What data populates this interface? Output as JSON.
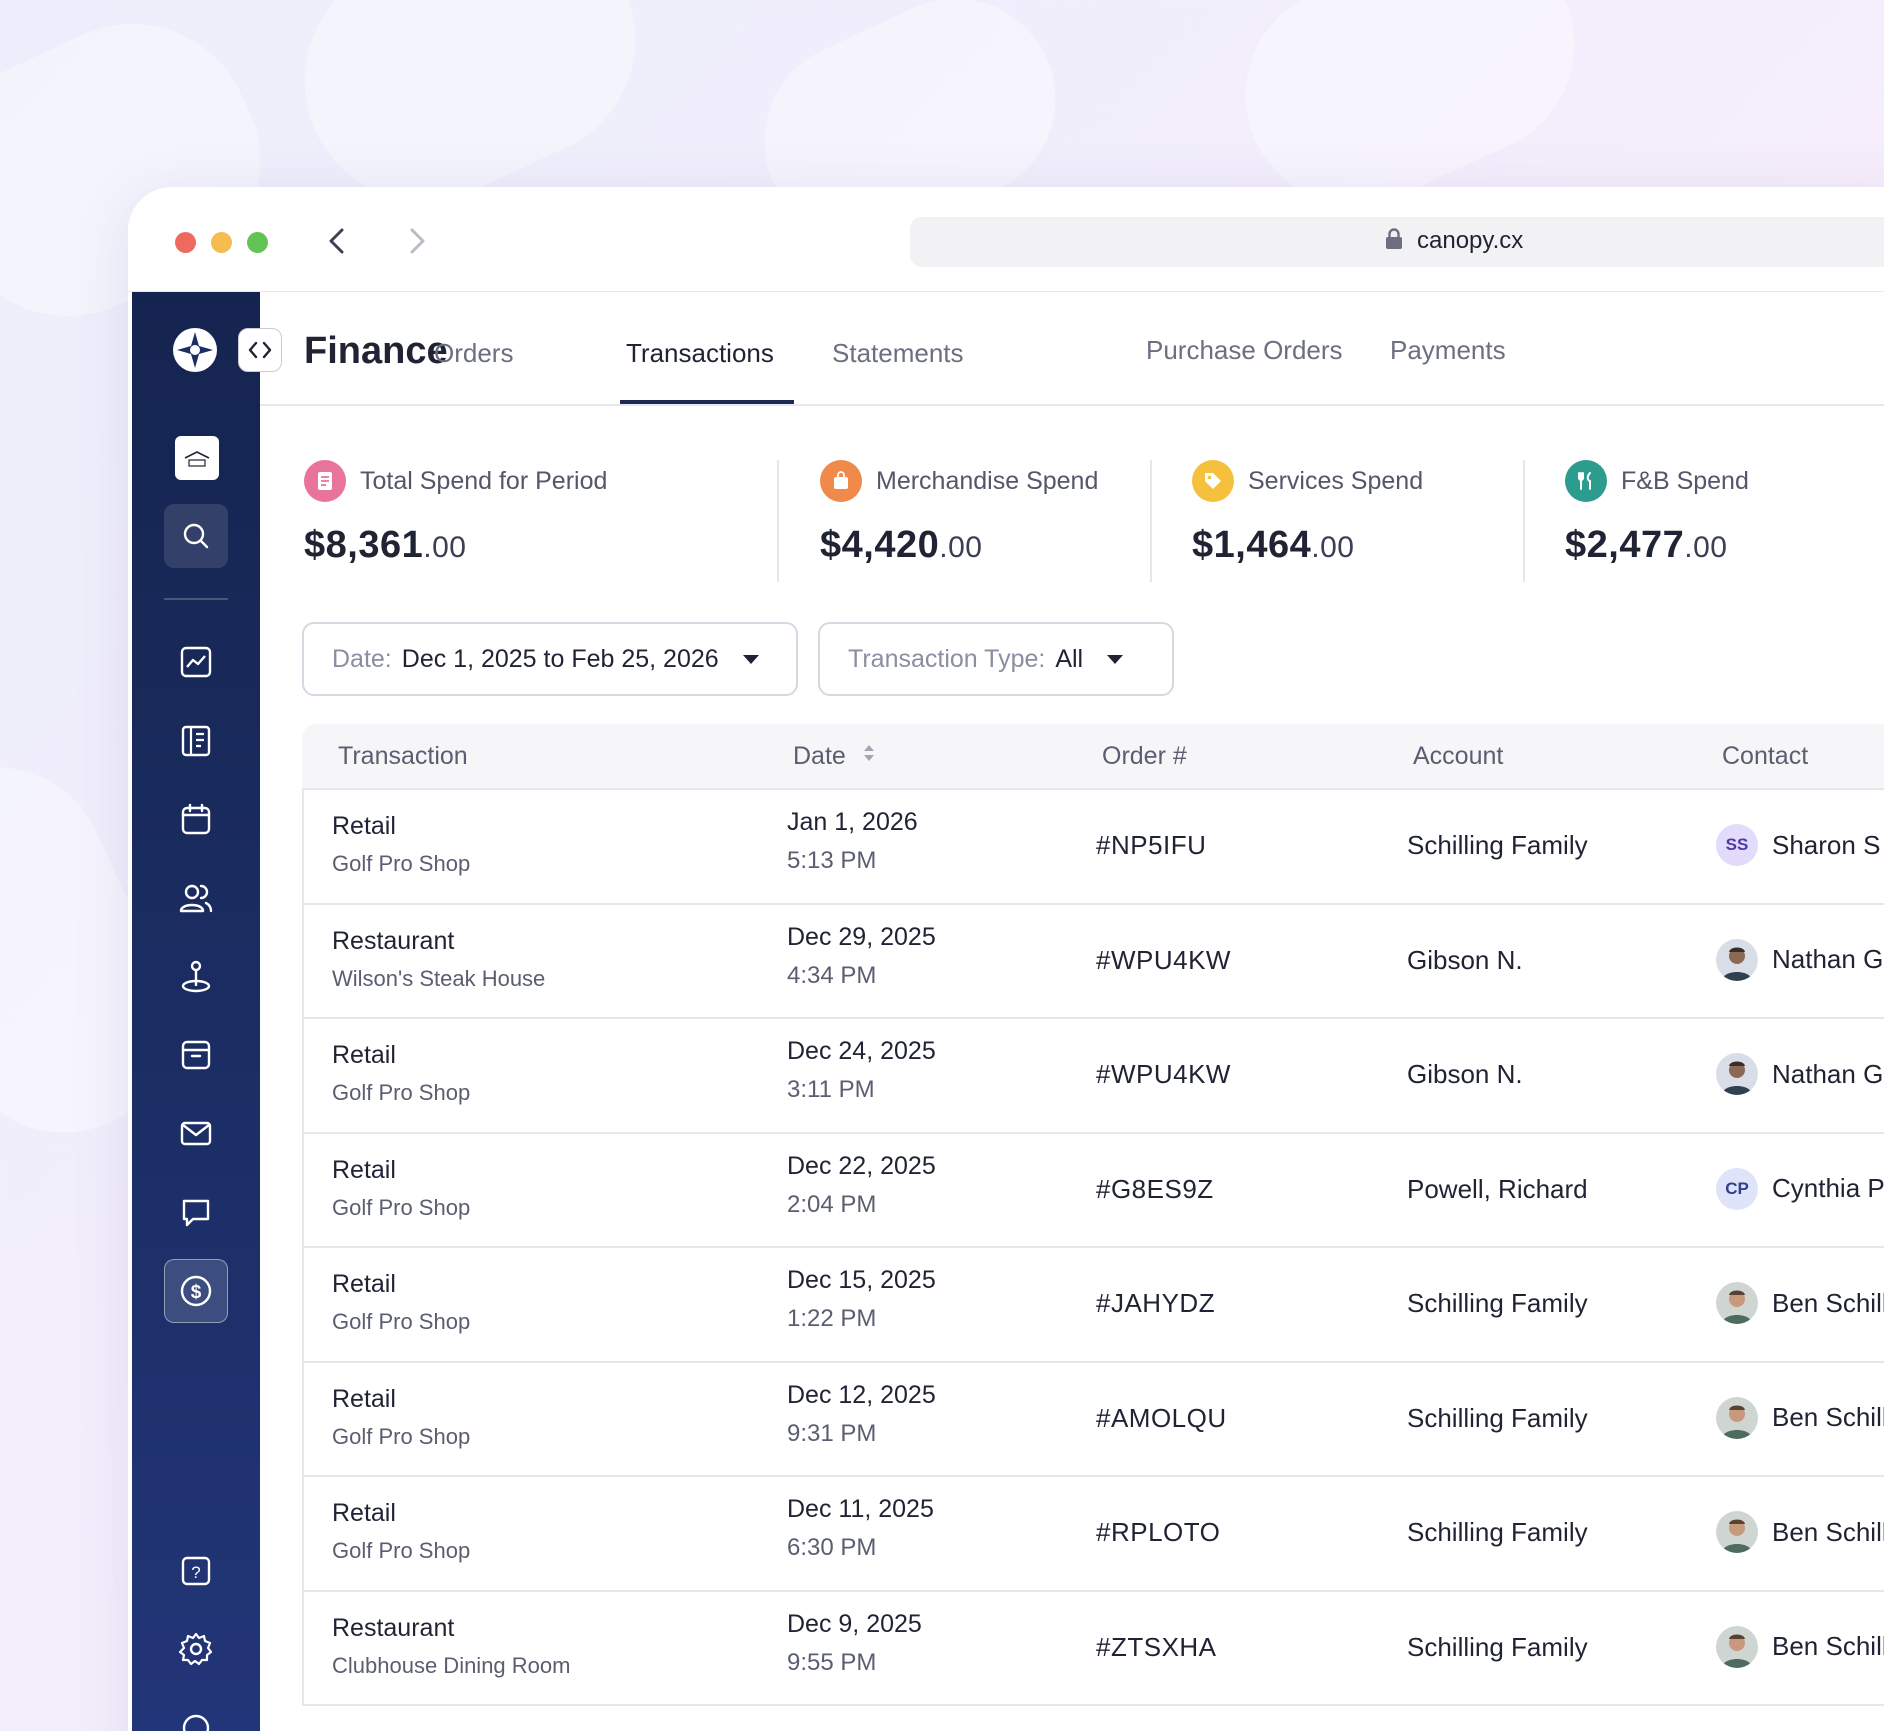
{
  "browser": {
    "url": "canopy.cx"
  },
  "app": {
    "title": "Finance",
    "tabs": [
      {
        "label": "Orders"
      },
      {
        "label": "Transactions"
      },
      {
        "label": "Statements"
      },
      {
        "label": "Purchase Orders"
      },
      {
        "label": "Payments"
      }
    ],
    "active_tab": "Transactions"
  },
  "sidebar": {
    "items": [
      "logo-icon",
      "club-badge",
      "search-icon",
      "chart-icon",
      "ledger-icon",
      "calendar-icon",
      "users-icon",
      "golf-pin-icon",
      "archive-icon",
      "mail-icon",
      "chat-icon",
      "dollar-icon",
      "help-icon",
      "gear-icon"
    ],
    "active": "dollar-icon"
  },
  "stats": [
    {
      "label": "Total Spend for Period",
      "value": "$8,361",
      "cents": ".00",
      "color": "#e8749a"
    },
    {
      "label": "Merchandise Spend",
      "value": "$4,420",
      "cents": ".00",
      "color": "#f08a4b"
    },
    {
      "label": "Services Spend",
      "value": "$1,464",
      "cents": ".00",
      "color": "#f5c03c"
    },
    {
      "label": "F&B Spend",
      "value": "$2,477",
      "cents": ".00",
      "color": "#2c9c8e"
    }
  ],
  "filters": {
    "date": {
      "key": "Date:",
      "value": "Dec 1, 2025 to Feb 25, 2026"
    },
    "type": {
      "key": "Transaction Type:",
      "value": "All"
    }
  },
  "table": {
    "headers": [
      "Transaction",
      "Date",
      "Order #",
      "Account",
      "Contact"
    ],
    "rows": [
      {
        "type": "Retail",
        "location": "Golf Pro Shop",
        "date": "Jan 1, 2026",
        "time": "5:13 PM",
        "order": "#NP5IFU",
        "account": "Schilling Family",
        "contact": "Sharon S",
        "initials": "SS"
      },
      {
        "type": "Restaurant",
        "location": "Wilson's Steak House",
        "date": "Dec 29, 2025",
        "time": "4:34 PM",
        "order": "#WPU4KW",
        "account": "Gibson N.",
        "contact": "Nathan G",
        "initials": ""
      },
      {
        "type": "Retail",
        "location": "Golf Pro Shop",
        "date": "Dec 24, 2025",
        "time": "3:11 PM",
        "order": "#WPU4KW",
        "account": "Gibson N.",
        "contact": "Nathan G",
        "initials": ""
      },
      {
        "type": "Retail",
        "location": "Golf Pro Shop",
        "date": "Dec 22, 2025",
        "time": "2:04 PM",
        "order": "#G8ES9Z",
        "account": "Powell, Richard",
        "contact": "Cynthia P",
        "initials": "CP"
      },
      {
        "type": "Retail",
        "location": "Golf Pro Shop",
        "date": "Dec 15, 2025",
        "time": "1:22 PM",
        "order": "#JAHYDZ",
        "account": "Schilling Family",
        "contact": "Ben Schilling",
        "initials": ""
      },
      {
        "type": "Retail",
        "location": "Golf Pro Shop",
        "date": "Dec 12, 2025",
        "time": "9:31 PM",
        "order": "#AMOLQU",
        "account": "Schilling Family",
        "contact": "Ben Schilling",
        "initials": ""
      },
      {
        "type": "Retail",
        "location": "Golf Pro Shop",
        "date": "Dec 11, 2025",
        "time": "6:30 PM",
        "order": "#RPLOTO",
        "account": "Schilling Family",
        "contact": "Ben Schilling",
        "initials": ""
      },
      {
        "type": "Restaurant",
        "location": "Clubhouse Dining Room",
        "date": "Dec 9, 2025",
        "time": "9:55 PM",
        "order": "#ZTSXHA",
        "account": "Schilling Family",
        "contact": "Ben Schilling",
        "initials": ""
      }
    ]
  }
}
